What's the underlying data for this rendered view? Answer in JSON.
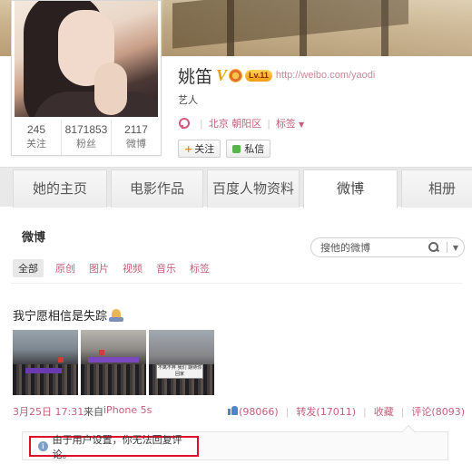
{
  "profile": {
    "name": "姚笛",
    "verified_badge": "V",
    "level_badge": "Lv.11",
    "url": "http://weibo.com/yaodi",
    "title": "艺人",
    "location": "北京 朝阳区",
    "tags_label": "标签",
    "follow_label": "关注",
    "message_label": "私信",
    "stats": [
      {
        "value": "245",
        "label": "关注"
      },
      {
        "value": "8171853",
        "label": "粉丝"
      },
      {
        "value": "2117",
        "label": "微博"
      }
    ]
  },
  "tabs": [
    {
      "label": "她的主页",
      "active": false
    },
    {
      "label": "电影作品",
      "active": false
    },
    {
      "label": "百度人物资料",
      "active": false
    },
    {
      "label": "微博",
      "active": true
    },
    {
      "label": "相册",
      "active": false
    }
  ],
  "weibo": {
    "section_title": "微博",
    "search_placeholder": "搜他的微博",
    "filters": [
      "全部",
      "原创",
      "图片",
      "视频",
      "音乐",
      "标签"
    ],
    "post": {
      "text": "我宁愿相信是失踪",
      "photo_sign_text": "不离不弃 我们 期待你回家",
      "time": "3月25日 17:31",
      "source_label": "来自",
      "source": "iPhone 5s",
      "likes": "(98066)",
      "repost": "转发(17011)",
      "favorite": "收藏",
      "comment": "评论(8093)"
    },
    "notice": "由于用户设置，你无法回复评论。"
  },
  "colors": {
    "link": "#c2607b",
    "notice_border": "#e0102b",
    "badge_gold": "#e8a100"
  },
  "icons": [
    "location-pin-icon",
    "search-icon",
    "pray-hands-icon",
    "thumbs-up-icon",
    "info-icon"
  ]
}
